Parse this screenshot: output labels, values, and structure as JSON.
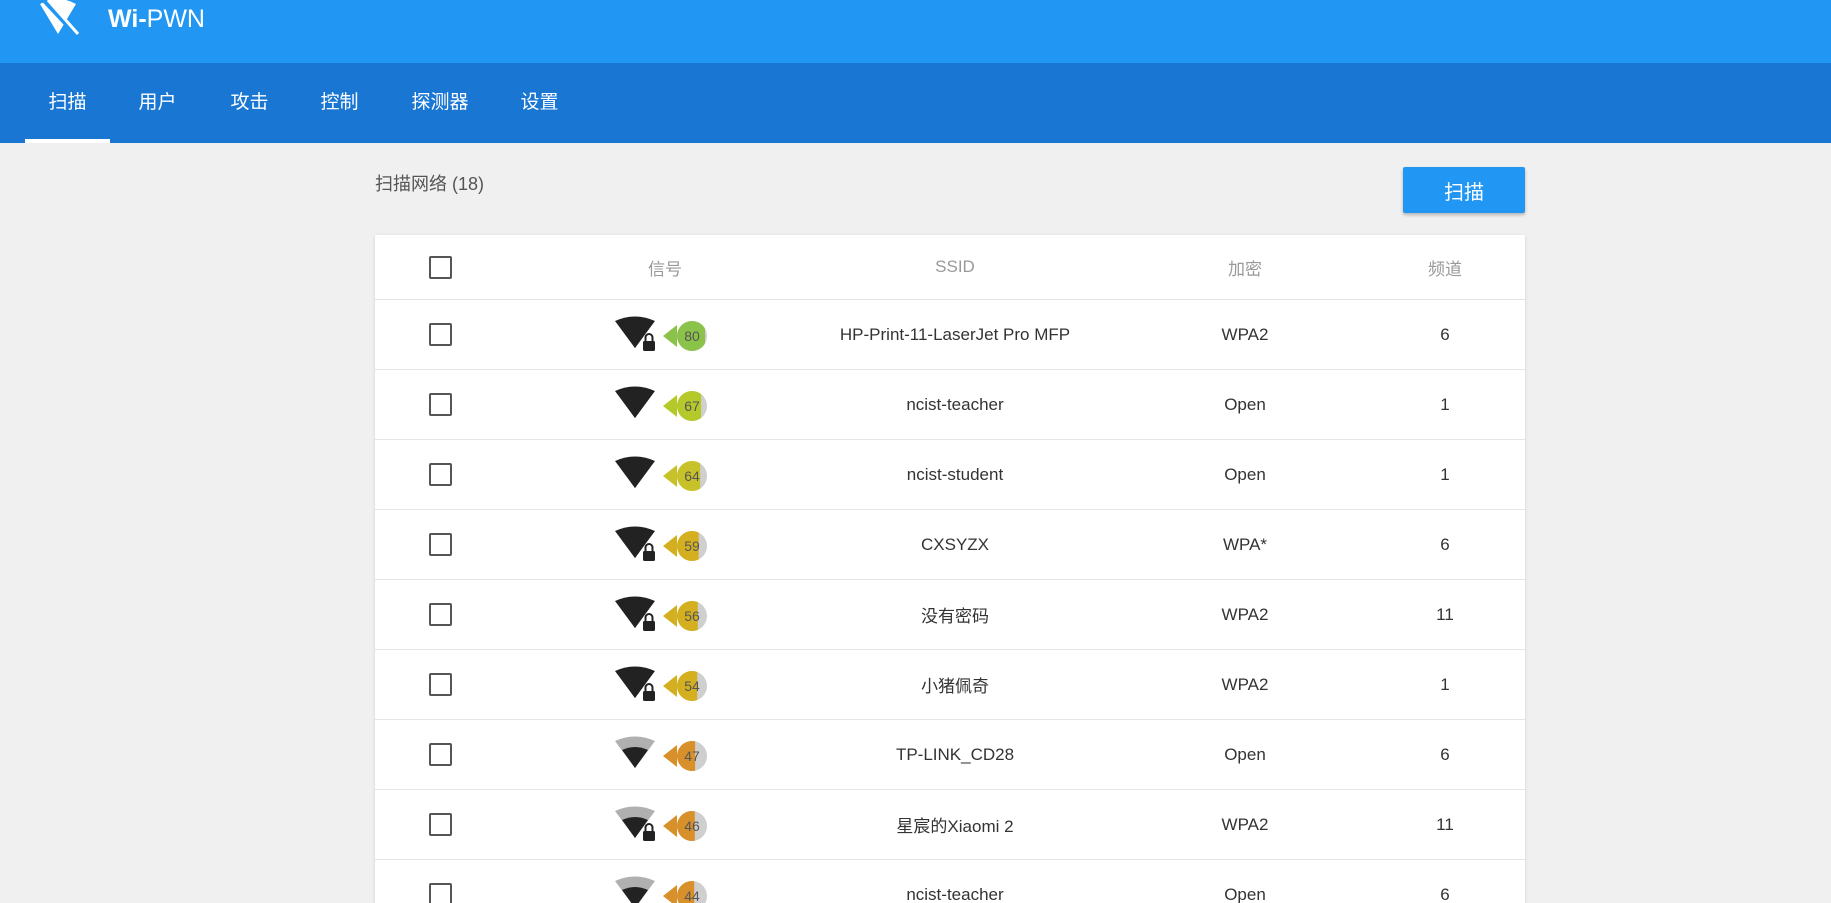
{
  "app": {
    "brand_bold": "Wi-",
    "brand_rest": "PWN",
    "logo_icon": "wifi-off-icon"
  },
  "nav": {
    "tabs": [
      {
        "label": "扫描",
        "active": true
      },
      {
        "label": "用户",
        "active": false
      },
      {
        "label": "攻击",
        "active": false
      },
      {
        "label": "控制",
        "active": false
      },
      {
        "label": "探测器",
        "active": false
      },
      {
        "label": "设置",
        "active": false
      }
    ]
  },
  "main": {
    "title": "扫描网络 (18)",
    "scan_button": "扫描"
  },
  "table": {
    "columns": {
      "signal": "信号",
      "ssid": "SSID",
      "encryption": "加密",
      "channel": "频道"
    },
    "rows": [
      {
        "signal": "80",
        "locked": true,
        "ssid": "HP-Print-11-LaserJet Pro MFP",
        "encryption": "WPA2",
        "channel": "6"
      },
      {
        "signal": "67",
        "locked": false,
        "ssid": "ncist-teacher",
        "encryption": "Open",
        "channel": "1"
      },
      {
        "signal": "64",
        "locked": false,
        "ssid": "ncist-student",
        "encryption": "Open",
        "channel": "1"
      },
      {
        "signal": "59",
        "locked": true,
        "ssid": "CXSYZX",
        "encryption": "WPA*",
        "channel": "6"
      },
      {
        "signal": "56",
        "locked": true,
        "ssid": "没有密码",
        "encryption": "WPA2",
        "channel": "11"
      },
      {
        "signal": "54",
        "locked": true,
        "ssid": "小猪佩奇",
        "encryption": "WPA2",
        "channel": "1"
      },
      {
        "signal": "47",
        "locked": false,
        "ssid": "TP-LINK_CD28",
        "encryption": "Open",
        "channel": "6"
      },
      {
        "signal": "46",
        "locked": true,
        "ssid": "星宸的Xiaomi 2",
        "encryption": "WPA2",
        "channel": "11"
      },
      {
        "signal": "44",
        "locked": false,
        "ssid": "ncist-teacher",
        "encryption": "Open",
        "channel": "6"
      }
    ]
  },
  "colors": {
    "topbar": "#2196f3",
    "navbar": "#1976d2"
  }
}
